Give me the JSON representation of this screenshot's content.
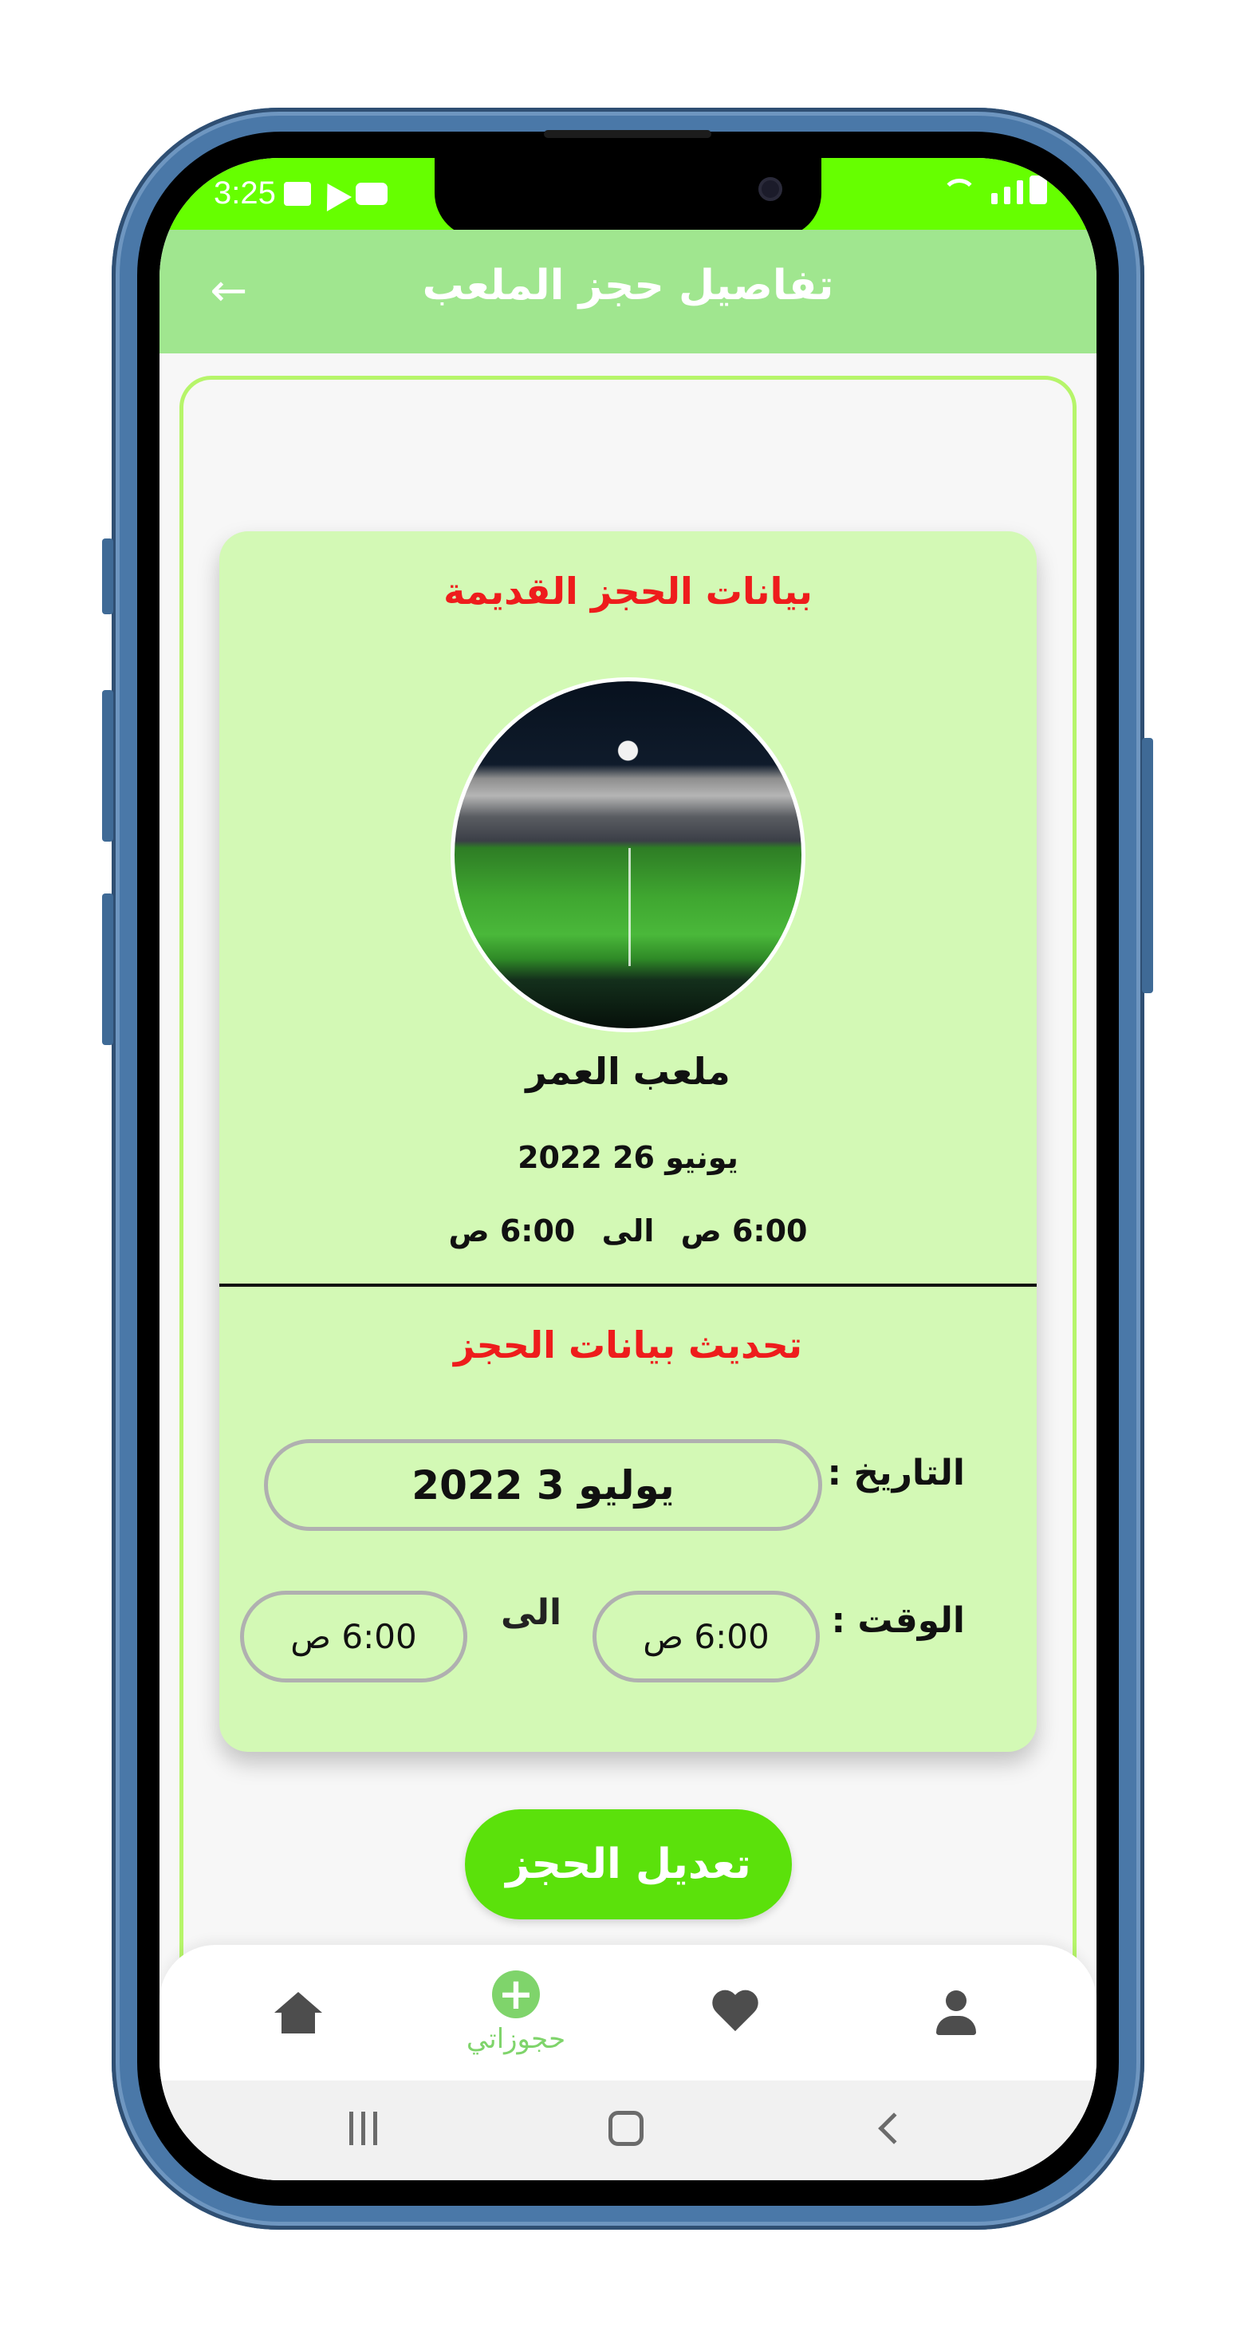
{
  "status_bar": {
    "time": "3:25",
    "color": "#66ff00"
  },
  "app_bar": {
    "title": "تفاصيل حجز الملعب",
    "back_icon": "arrow-back-icon",
    "color": "#a0e68f"
  },
  "old_booking": {
    "section_title": "بيانات الحجز القديمة",
    "stadium_name": "ملعب العمر",
    "date": "يونيو 26 2022",
    "time_from": "6:00 ص",
    "time_separator": "الى",
    "time_to": "6:00 ص"
  },
  "update_booking": {
    "section_title": "تحديث بيانات الحجز",
    "date_label": "التاريخ :",
    "date_value": "يوليو 3 2022",
    "time_label": "الوقت :",
    "time_from": "6:00 ص",
    "time_separator": "الى",
    "time_to": "6:00 ص"
  },
  "edit_button": {
    "label": "تعديل الحجز",
    "color": "#5be10b"
  },
  "bottom_nav": {
    "items": [
      {
        "icon": "home-icon",
        "label": ""
      },
      {
        "icon": "add-circle-icon",
        "label": "حجوزاتي",
        "active": true
      },
      {
        "icon": "heart-icon",
        "label": ""
      },
      {
        "icon": "person-icon",
        "label": ""
      }
    ],
    "active_color": "#7fd46b"
  },
  "colors": {
    "card_background": "#d3f9b5",
    "section_title": "#ee1c1c",
    "frame_border": "#b6f56a"
  }
}
